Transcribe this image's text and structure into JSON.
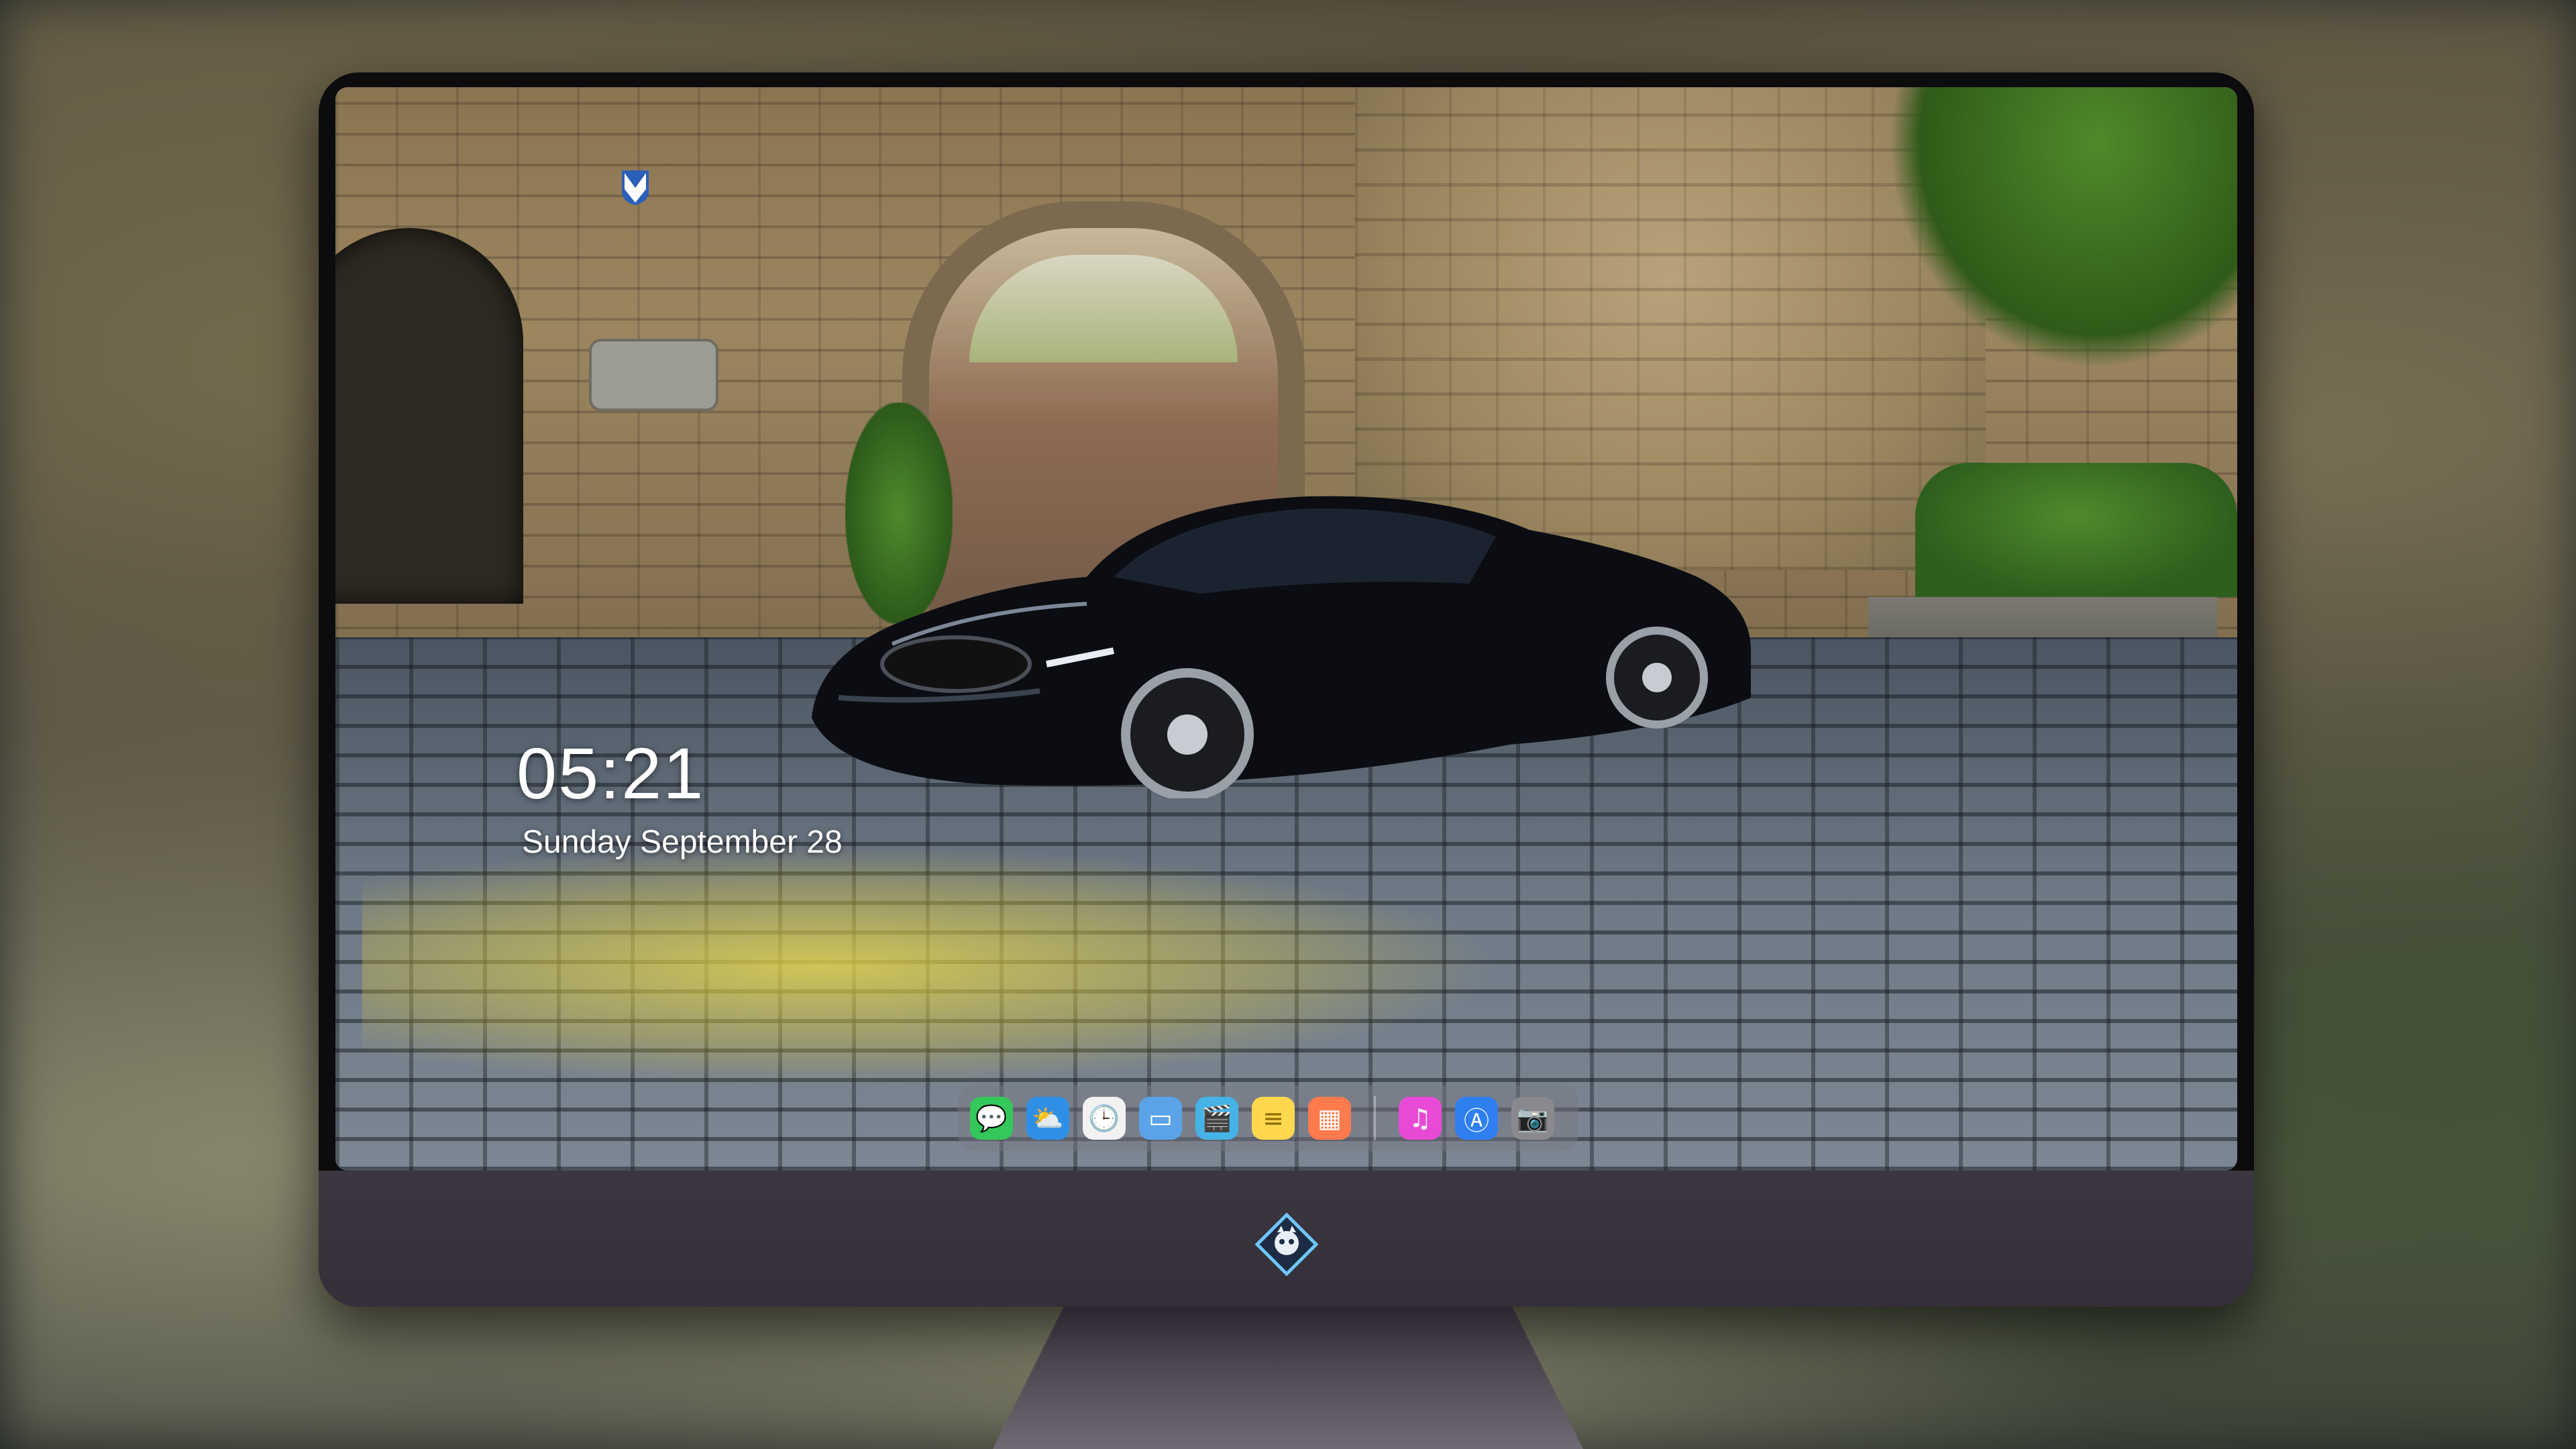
{
  "lockscreen": {
    "time": "05:21",
    "date": "Sunday  September  28"
  },
  "dock": {
    "apps": [
      {
        "name": "Messages",
        "icon": "messages-icon",
        "color": "#34c759",
        "glyph": "💬"
      },
      {
        "name": "Weather",
        "icon": "weather-icon",
        "color": "#2f8fe6",
        "glyph": "⛅"
      },
      {
        "name": "Clock",
        "icon": "clock-icon",
        "color": "#f2f2f2",
        "glyph": "🕒"
      },
      {
        "name": "Preview",
        "icon": "preview-icon",
        "color": "#5aa3e8",
        "glyph": "▭"
      },
      {
        "name": "Video",
        "icon": "clapper-icon",
        "color": "#46b3e6",
        "glyph": "🎬"
      },
      {
        "name": "Notes",
        "icon": "notes-icon",
        "color": "#ffd84d",
        "glyph": "≡"
      },
      {
        "name": "Photo Booth",
        "icon": "photos-icon",
        "color": "#ff7a4d",
        "glyph": "▦"
      },
      {
        "name": "Music",
        "icon": "music-icon",
        "color": "#e84ad6",
        "glyph": "♫"
      },
      {
        "name": "App Store",
        "icon": "app-store-icon",
        "color": "#2f7ff0",
        "glyph": "Ⓐ"
      },
      {
        "name": "Camera",
        "icon": "camera-icon",
        "color": "#8a8a8e",
        "glyph": "📷"
      }
    ]
  },
  "colors": {
    "monitor_chin": "#3a343e",
    "dock_bg": "rgba(120,120,130,0.45)"
  }
}
